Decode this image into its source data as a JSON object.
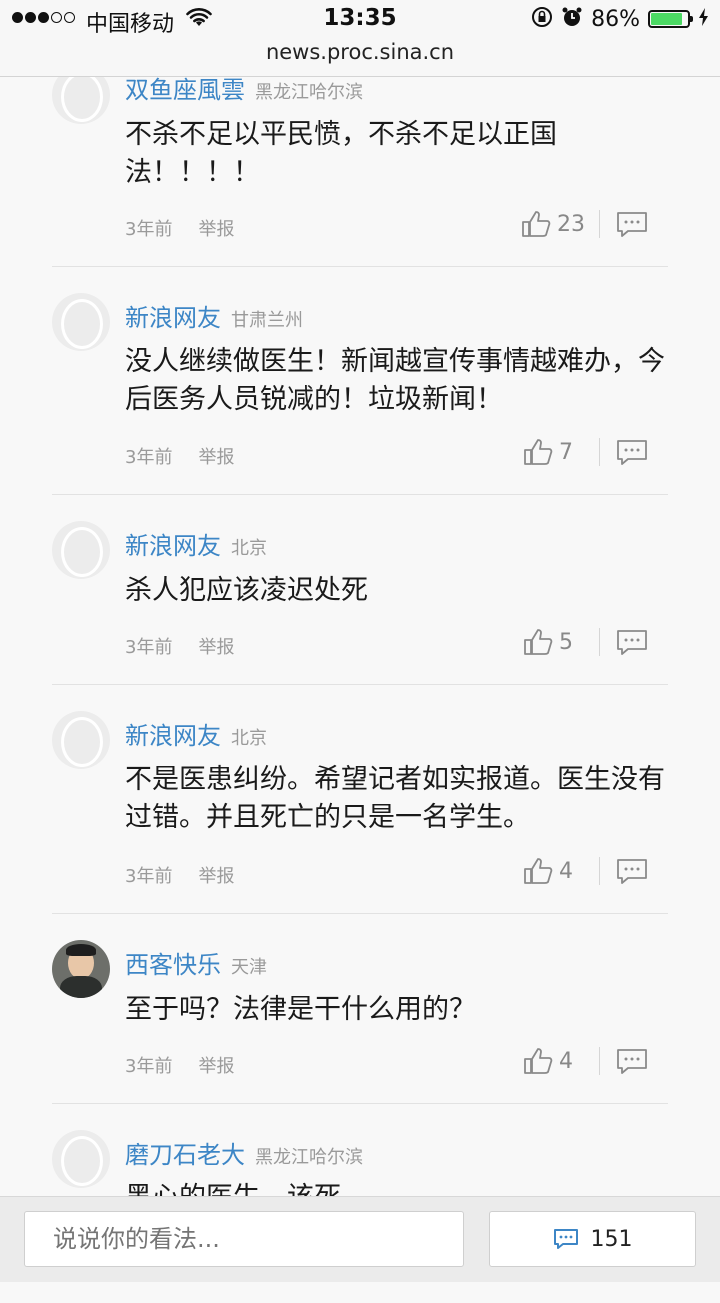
{
  "status_bar": {
    "carrier": "中国移动",
    "time": "13:35",
    "battery": "86%",
    "battery_level": 0.86
  },
  "address_bar": {
    "url": "news.proc.sina.cn"
  },
  "comments": [
    {
      "username": "双鱼座風雲",
      "location": "黑龙江哈尔滨",
      "text": "不杀不足以平民愤，不杀不足以正国法！！！！",
      "time": "3年前",
      "report": "举报",
      "likes": "23"
    },
    {
      "username": "新浪网友",
      "location": "甘肃兰州",
      "text": "没人继续做医生！新闻越宣传事情越难办，今后医务人员锐减的！垃圾新闻！",
      "time": "3年前",
      "report": "举报",
      "likes": "7"
    },
    {
      "username": "新浪网友",
      "location": "北京",
      "text": "杀人犯应该凌迟处死",
      "time": "3年前",
      "report": "举报",
      "likes": "5"
    },
    {
      "username": "新浪网友",
      "location": "北京",
      "text": "不是医患纠纷。希望记者如实报道。医生没有过错。并且死亡的只是一名学生。",
      "time": "3年前",
      "report": "举报",
      "likes": "4"
    },
    {
      "username": "西客快乐",
      "location": "天津",
      "text": "至于吗？法律是干什么用的？",
      "time": "3年前",
      "report": "举报",
      "likes": "4"
    },
    {
      "username": "磨刀石老大",
      "location": "黑龙江哈尔滨",
      "text": "黑心的医生，该死。",
      "time": "",
      "report": "",
      "likes": ""
    }
  ],
  "bottom_bar": {
    "input_placeholder": "说说你的看法...",
    "comment_count": "151"
  }
}
